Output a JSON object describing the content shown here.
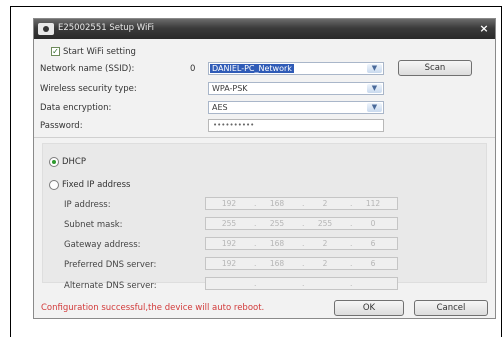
{
  "window": {
    "title": "E25002551  Setup WiFi",
    "close_label": "×"
  },
  "start_wifi": {
    "label": "Start WiFi setting",
    "checked": true
  },
  "network_name": {
    "label": "Network name (SSID):",
    "count": "0",
    "value": "DANIEL-PC_Network"
  },
  "scan_label": "Scan",
  "security_type": {
    "label": "Wireless security type:",
    "value": "WPA-PSK"
  },
  "encryption": {
    "label": "Data encryption:",
    "value": "AES"
  },
  "password": {
    "label": "Password:",
    "value": "••••••••••"
  },
  "ip_mode": {
    "dhcp_label": "DHCP",
    "fixed_label": "Fixed IP address",
    "selected": "DHCP"
  },
  "ip_fields": [
    {
      "label": "IP address:",
      "octets": [
        "192",
        "168",
        "2",
        "112"
      ]
    },
    {
      "label": "Subnet mask:",
      "octets": [
        "255",
        "255",
        "255",
        "0"
      ]
    },
    {
      "label": "Gateway address:",
      "octets": [
        "192",
        "168",
        "2",
        "6"
      ]
    },
    {
      "label": "Preferred DNS server:",
      "octets": [
        "192",
        "168",
        "2",
        "6"
      ]
    },
    {
      "label": "Alternate DNS server:",
      "octets": [
        "",
        "",
        "",
        ""
      ]
    }
  ],
  "status_message": "Configuration successful,the device will auto reboot.",
  "buttons": {
    "ok_label": "OK",
    "cancel_label": "Cancel"
  },
  "icons": {
    "app": "router-icon",
    "close": "close-icon",
    "dropdown": "chevron-down-icon"
  },
  "colors": {
    "titlebar": "#2a2a2a",
    "selection": "#2f5bb7",
    "status": "#d23a3a"
  }
}
